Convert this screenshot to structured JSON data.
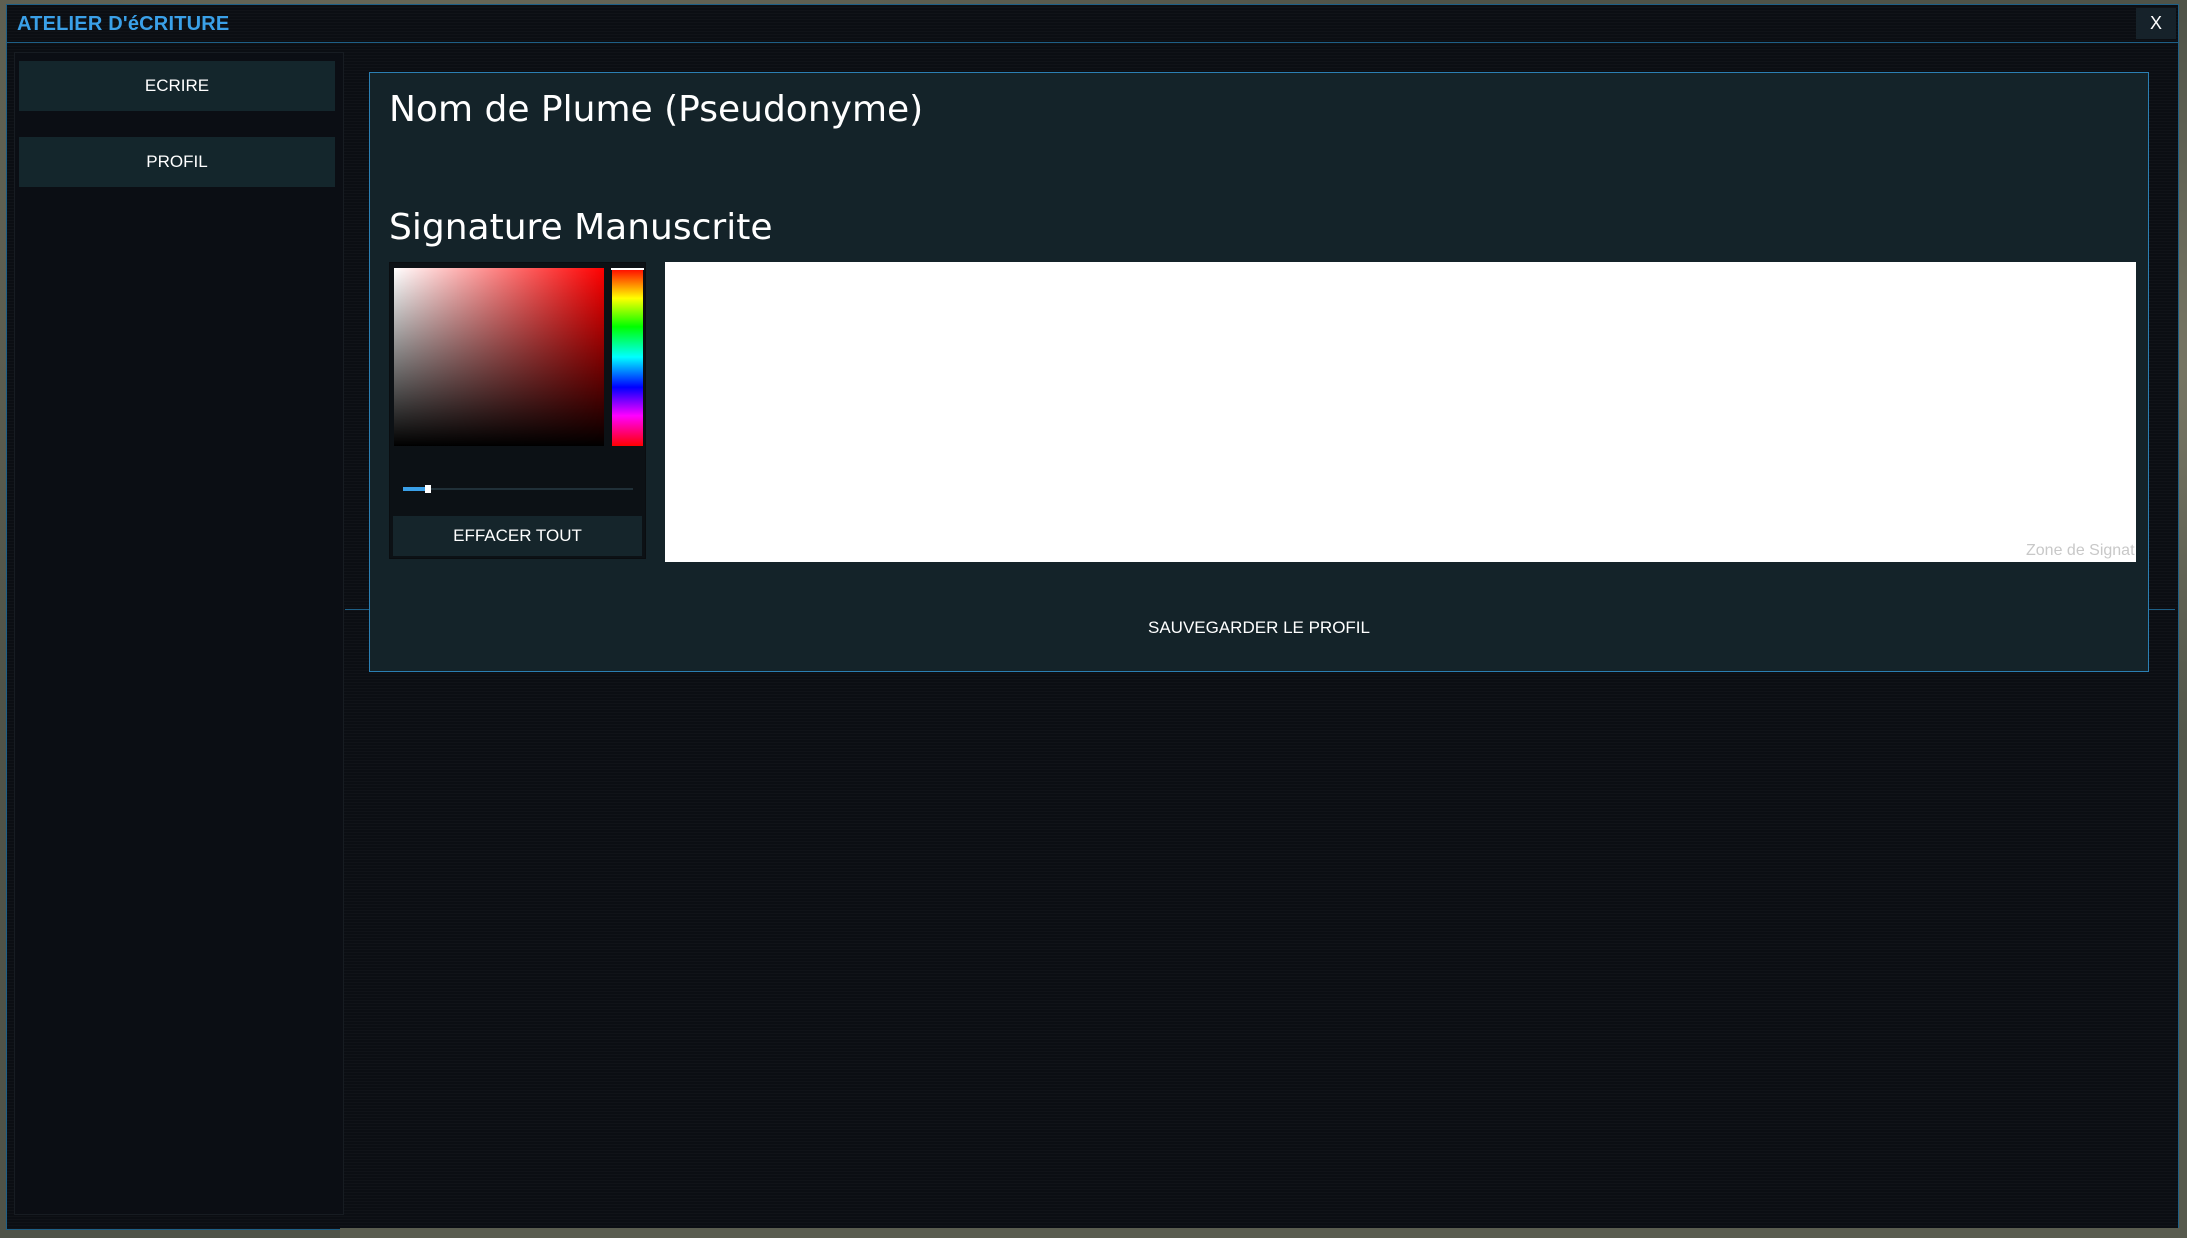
{
  "window": {
    "title": "ATELIER D'éCRITURE",
    "close_label": "X"
  },
  "sidebar": {
    "items": [
      {
        "label": "ECRIRE"
      },
      {
        "label": "PROFIL"
      }
    ]
  },
  "profile": {
    "pseudonym_heading": "Nom de Plume (Pseudonyme)",
    "signature_heading": "Signature Manuscrite",
    "clear_label": "EFFACER TOUT",
    "canvas_placeholder": "Zone de Signat",
    "save_label": "SAUVEGARDER LE PROFIL",
    "brush_size_fraction": 0.11,
    "selected_hue_color": "#ff0000"
  },
  "colors": {
    "accent": "#3aa0e8",
    "window_border": "#1e5f86",
    "panel_bg": "#142329",
    "button_bg": "#14262c"
  }
}
